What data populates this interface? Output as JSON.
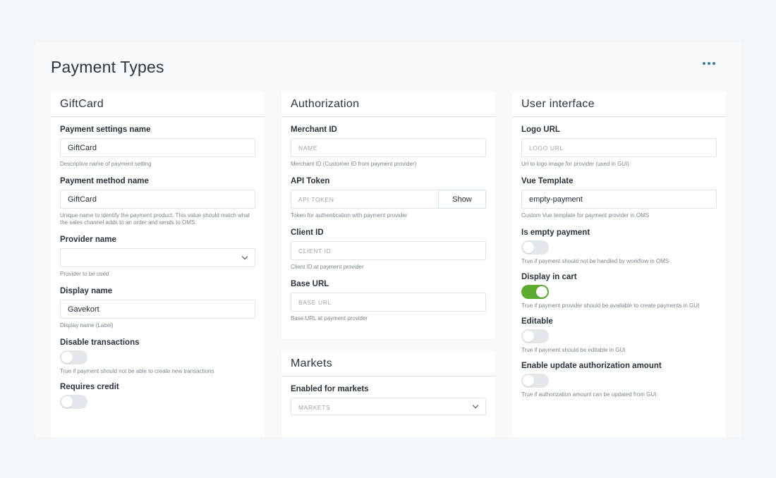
{
  "page": {
    "title": "Payment Types"
  },
  "giftcard": {
    "title": "GiftCard",
    "payment_settings_name": {
      "label": "Payment settings name",
      "value": "GiftCard",
      "help": "Descriptive name of payment setting"
    },
    "payment_method_name": {
      "label": "Payment method name",
      "value": "GiftCard",
      "help": "Unique name to identify the payment product. This value should match what the sales channel adds to an order and sends to OMS."
    },
    "provider_name": {
      "label": "Provider name",
      "value": "",
      "help": "Provider to be used"
    },
    "display_name": {
      "label": "Display name",
      "value": "Gavekort",
      "help": "Display name (Label)"
    },
    "disable_transactions": {
      "label": "Disable transactions",
      "on": false,
      "help": "True if payment should not be able to create new transactions"
    },
    "requires_credit": {
      "label": "Requires credit",
      "on": false
    }
  },
  "authorization": {
    "title": "Authorization",
    "merchant_id": {
      "label": "Merchant ID",
      "placeholder": "NAME",
      "help": "Merchant ID (Customer ID from payment provider)"
    },
    "api_token": {
      "label": "API Token",
      "placeholder": "API TOKEN",
      "button": "Show",
      "help": "Token for authentication with payment provider"
    },
    "client_id": {
      "label": "Client ID",
      "placeholder": "CLIENT ID",
      "help": "Client ID at payment provider"
    },
    "base_url": {
      "label": "Base URL",
      "placeholder": "BASE URL",
      "help": "Base URL at payment provider"
    }
  },
  "markets": {
    "title": "Markets",
    "enabled_for_markets": {
      "label": "Enabled for markets",
      "placeholder": "MARKETS"
    }
  },
  "user_interface": {
    "title": "User interface",
    "logo_url": {
      "label": "Logo URL",
      "placeholder": "LOGO URL",
      "help": "Url to logo image for provider (used in GUI)"
    },
    "vue_template": {
      "label": "Vue Template",
      "value": "empty-payment",
      "help": "Custom Vue template for payment provider in OMS"
    },
    "is_empty_payment": {
      "label": "Is empty payment",
      "on": false,
      "help": "True if payment should not be handled by workflow in OMS"
    },
    "display_in_cart": {
      "label": "Display in cart",
      "on": true,
      "help": "True if payment provider should be available to create payments in GUI"
    },
    "editable": {
      "label": "Editable",
      "on": false,
      "help": "True if payment should be editable in GUI"
    },
    "enable_update_authorization_amount": {
      "label": "Enable update authorization amount",
      "on": false,
      "help": "True if authorization amount can be updated from GUI"
    }
  },
  "colors": {
    "accent": "#3d7f97",
    "toggle_on": "#5aab2e",
    "toggle_off": "#e3e7ea",
    "background": "#f3f6f8"
  },
  "icons": {
    "more_menu": "more-horizontal-icon",
    "dropdown": "chevron-down-icon"
  }
}
